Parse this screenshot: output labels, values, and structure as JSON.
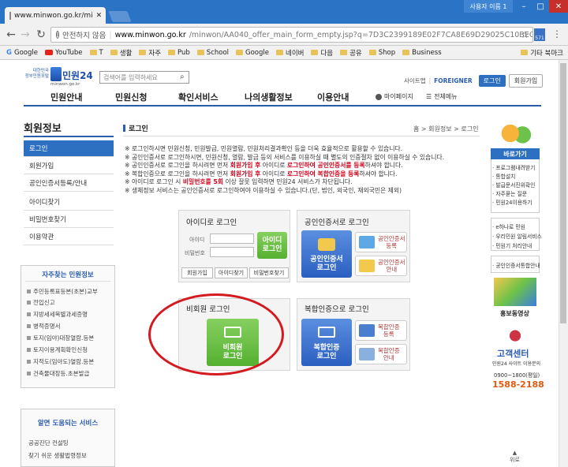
{
  "browser": {
    "tab_title": "www.minwon.go.kr/mi",
    "user_badge": "사용자 이름 1",
    "security_label": "안전하지 않음",
    "url_host": "www.minwon.go.kr",
    "url_path": "/minwon/AA040_offer_main_form_empty.jsp?q=7D3C2399189E02F7CA8E69D29025C10BEC...",
    "ext_badge": "571",
    "bookmarks": [
      "Google",
      "YouTube",
      "T",
      "생활",
      "자주",
      "Pub",
      "School",
      "Google",
      "네이버",
      "다음",
      "공유",
      "Shop",
      "Business"
    ],
    "bookmarks_other": "기타 북마크"
  },
  "site": {
    "logo_line1": "대한민국",
    "logo_line2": "정부민원포털",
    "logo_name": "민원24",
    "logo_sub": "minwon.go.kr",
    "search_placeholder": "검색어를 입력하세요",
    "top_links": [
      "사이트맵",
      "FOREIGNER"
    ],
    "login_btn": "로그인",
    "join_btn": "회원가입",
    "gnb": [
      "민원안내",
      "민원신청",
      "확인서비스",
      "나의생활정보",
      "이용안내"
    ],
    "mypage": "마이페이지",
    "allmenu": "전체메뉴"
  },
  "sidebar": {
    "title": "회원정보",
    "items": [
      "로그인",
      "회원가입",
      "공인인증서등록/안내",
      "아이디찾기",
      "비밀번호찾기",
      "이용약관"
    ],
    "faq_title": "자주찾는 민원정보",
    "faq": [
      "주민등록표등본(초본)교부",
      "전입신고",
      "지방세세목별과세증명",
      "병적증명서",
      "토지(임야)대장열람.등본",
      "토지이용계획확인신청",
      "지적도(임야도)열람.등본",
      "건축물대장등.초본발급"
    ],
    "help_title": "알면 도움되는 서비스",
    "help": [
      "공공진단 컨설팅",
      "찾기 쉬운 생활법령정보"
    ]
  },
  "content": {
    "title": "로그인",
    "breadcrumb": "홈 > 회원정보 > 로그인",
    "notes": [
      [
        "※ 로그인하시면 민원신청, 민원발급, 민원열람, 민원처리결과확인 등을 더욱 효율적으로 활용할 수 있습니다."
      ],
      [
        "※ 공인인증서로 로그인하시면, 민원신청, 열람, 발급 등의 서비스를 이용하실 때 별도의 인증절차 없이 이용하실 수 있습니다."
      ],
      [
        "※ 공인인증서로 로그인을 하시려면 먼저 ",
        "회원가입 후",
        " 아이디로 ",
        "로그인하여 공인인증서를 등록",
        "하셔야 합니다."
      ],
      [
        "※ 복합인증으로 로그인을 하시려면 먼저 ",
        "회원가입 후",
        " 아이디로 ",
        "로그인하여 복합인증을 등록",
        "하셔야 합니다."
      ],
      [
        "※ 아이디로 로그인 시 ",
        "비밀번호를 5회",
        " 이상 잘못 입력하면 민원24 서비스가 차단됩니다."
      ],
      [
        "※ 생체정보 서비스는 공인인증서로 로그인하여야 이용하실 수 있습니다.(단, 법인, 외국인, 재외국민은 제외)"
      ]
    ],
    "id_login": {
      "title": "아이디로 로그인",
      "id_label": "아이디",
      "pw_label": "비밀번호",
      "btn": [
        "아이디",
        "로그인"
      ],
      "links": [
        "회원가입",
        "아이디찾기",
        "비밀번호찾기"
      ]
    },
    "cert_login": {
      "title": "공인인증서로 로그인",
      "btn": [
        "공인인증서",
        "로그인"
      ],
      "opt1": [
        "공인인증서",
        "등록"
      ],
      "opt2": [
        "공인인증서",
        "안내"
      ]
    },
    "guest_login": {
      "title": "비회원 로그인",
      "btn": [
        "비회원",
        "로그인"
      ]
    },
    "multi_login": {
      "title": "복합인증으로 로그인",
      "btn": [
        "복합인증",
        "로그인"
      ],
      "opt1": [
        "복합인증",
        "등록"
      ],
      "opt2": [
        "복합인증",
        "안내"
      ]
    }
  },
  "rail": {
    "quick_title": "바로가기",
    "quick": [
      "· 프로그램내려받기",
      "· 통합설치",
      "· 발급문서진위확인",
      "· 자주묻는 질문",
      "· 민원24이용하기"
    ],
    "quick2": [
      "· e하나로 민원",
      "· 우리민원 알림서비스",
      "· 민원기 처리안내"
    ],
    "quick3": [
      "· 공인인증서통합안내"
    ],
    "promo": "홍보동영상",
    "center_title": "고객센터",
    "center_sub": "민원24 사이트 이용문의",
    "center_hours": "0900~1800(평일)",
    "center_phone": "1588-2188",
    "top": "위로"
  }
}
